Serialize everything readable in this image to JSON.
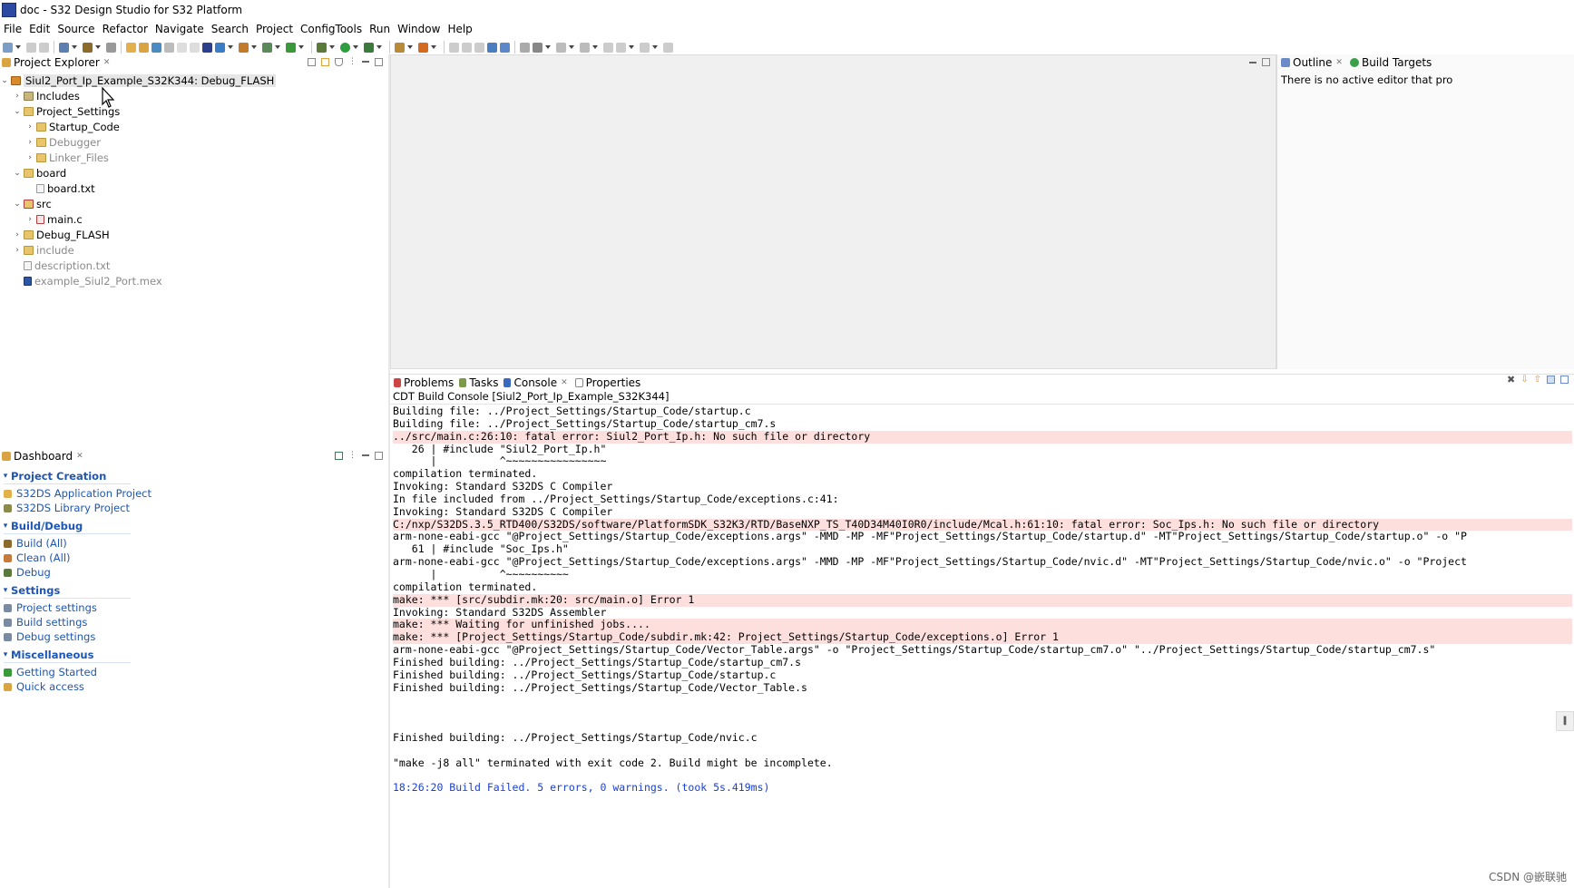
{
  "window": {
    "title": "doc - S32 Design Studio for S32 Platform"
  },
  "menu": [
    "File",
    "Edit",
    "Source",
    "Refactor",
    "Navigate",
    "Search",
    "Project",
    "ConfigTools",
    "Run",
    "Window",
    "Help"
  ],
  "project_explorer": {
    "title": "Project Explorer",
    "items": [
      {
        "label": "Siul2_Port_Ip_Example_S32K344: Debug_FLASH"
      },
      {
        "label": "Includes"
      },
      {
        "label": "Project_Settings"
      },
      {
        "label": "Startup_Code"
      },
      {
        "label": "Debugger"
      },
      {
        "label": "Linker_Files"
      },
      {
        "label": "board"
      },
      {
        "label": "board.txt"
      },
      {
        "label": "src"
      },
      {
        "label": "main.c"
      },
      {
        "label": "Debug_FLASH"
      },
      {
        "label": "include"
      },
      {
        "label": "description.txt"
      },
      {
        "label": "example_Siul2_Port.mex"
      }
    ]
  },
  "outline": {
    "tab_outline": "Outline",
    "tab_build_targets": "Build Targets",
    "message": "There is no active editor that pro"
  },
  "dashboard": {
    "title": "Dashboard",
    "sections": [
      {
        "title": "Project Creation",
        "items": [
          "S32DS Application Project",
          "S32DS Library Project"
        ]
      },
      {
        "title": "Build/Debug",
        "items": [
          "Build  (All)",
          "Clean  (All)",
          "Debug"
        ]
      },
      {
        "title": "Settings",
        "items": [
          "Project settings",
          "Build settings",
          "Debug settings"
        ]
      },
      {
        "title": "Miscellaneous",
        "items": [
          "Getting Started",
          "Quick access"
        ]
      }
    ]
  },
  "console": {
    "tabs": [
      "Problems",
      "Tasks",
      "Console",
      "Properties"
    ],
    "header": "CDT Build Console [Siul2_Port_Ip_Example_S32K344]",
    "lines": [
      {
        "text": "Building file: ../Project_Settings/Startup_Code/startup.c",
        "type": "normal"
      },
      {
        "text": "Building file: ../Project_Settings/Startup_Code/startup_cm7.s",
        "type": "normal"
      },
      {
        "text": "../src/main.c:26:10: fatal error: Siul2_Port_Ip.h: No such file or directory",
        "type": "error"
      },
      {
        "text": "   26 | #include \"Siul2_Port_Ip.h\"",
        "type": "normal"
      },
      {
        "text": "      |          ^~~~~~~~~~~~~~~~~",
        "type": "normal"
      },
      {
        "text": "compilation terminated.",
        "type": "normal"
      },
      {
        "text": "Invoking: Standard S32DS C Compiler",
        "type": "normal"
      },
      {
        "text": "In file included from ../Project_Settings/Startup_Code/exceptions.c:41:",
        "type": "normal"
      },
      {
        "text": "Invoking: Standard S32DS C Compiler",
        "type": "normal"
      },
      {
        "text": "C:/nxp/S32DS.3.5_RTD400/S32DS/software/PlatformSDK_S32K3/RTD/BaseNXP_TS_T40D34M40I0R0/include/Mcal.h:61:10: fatal error: Soc_Ips.h: No such file or directory",
        "type": "error"
      },
      {
        "text": "arm-none-eabi-gcc \"@Project_Settings/Startup_Code/exceptions.args\" -MMD -MP -MF\"Project_Settings/Startup_Code/startup.d\" -MT\"Project_Settings/Startup_Code/startup.o\" -o \"P",
        "type": "normal"
      },
      {
        "text": "   61 | #include \"Soc_Ips.h\"",
        "type": "normal"
      },
      {
        "text": "arm-none-eabi-gcc \"@Project_Settings/Startup_Code/exceptions.args\" -MMD -MP -MF\"Project_Settings/Startup_Code/nvic.d\" -MT\"Project_Settings/Startup_Code/nvic.o\" -o \"Project",
        "type": "normal"
      },
      {
        "text": "      |          ^~~~~~~~~~~",
        "type": "normal"
      },
      {
        "text": "compilation terminated.",
        "type": "normal"
      },
      {
        "text": "make: *** [src/subdir.mk:20: src/main.o] Error 1",
        "type": "error"
      },
      {
        "text": "Invoking: Standard S32DS Assembler",
        "type": "normal"
      },
      {
        "text": "make: *** Waiting for unfinished jobs....",
        "type": "error"
      },
      {
        "text": "make: *** [Project_Settings/Startup_Code/subdir.mk:42: Project_Settings/Startup_Code/exceptions.o] Error 1",
        "type": "error"
      },
      {
        "text": "arm-none-eabi-gcc \"@Project_Settings/Startup_Code/Vector_Table.args\" -o \"Project_Settings/Startup_Code/startup_cm7.o\" \"../Project_Settings/Startup_Code/startup_cm7.s\"",
        "type": "normal"
      },
      {
        "text": "Finished building: ../Project_Settings/Startup_Code/startup_cm7.s",
        "type": "normal"
      },
      {
        "text": "Finished building: ../Project_Settings/Startup_Code/startup.c",
        "type": "normal"
      },
      {
        "text": "Finished building: ../Project_Settings/Startup_Code/Vector_Table.s",
        "type": "normal"
      },
      {
        "text": "",
        "type": "normal"
      },
      {
        "text": "",
        "type": "normal"
      },
      {
        "text": "",
        "type": "normal"
      },
      {
        "text": "Finished building: ../Project_Settings/Startup_Code/nvic.c",
        "type": "normal"
      },
      {
        "text": "",
        "type": "normal"
      },
      {
        "text": "\"make -j8 all\" terminated with exit code 2. Build might be incomplete.",
        "type": "normal"
      },
      {
        "text": "",
        "type": "normal"
      },
      {
        "text": "18:26:20 Build Failed. 5 errors, 0 warnings. (took 5s.419ms)",
        "type": "blue"
      }
    ]
  },
  "watermark": "CSDN @嵌联驰",
  "colors": {
    "link": "#1e56b5",
    "error_bg": "#fde0de",
    "build_result": "#1a3fd3"
  }
}
